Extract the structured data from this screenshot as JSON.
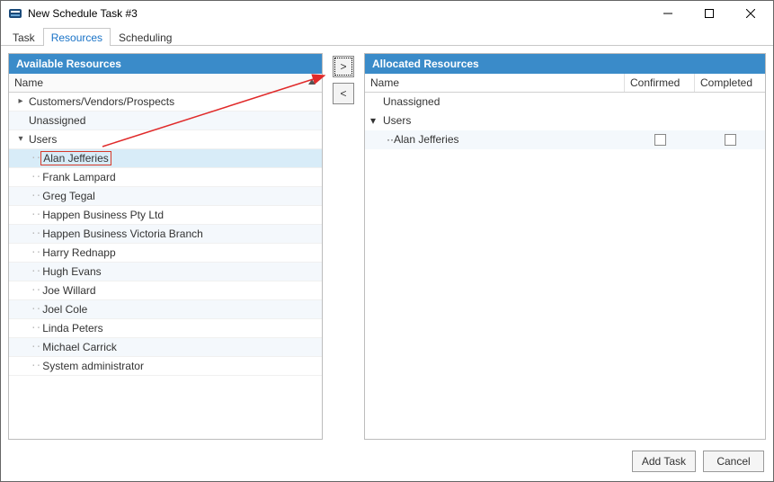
{
  "window": {
    "title": "New Schedule Task #3"
  },
  "tabs": {
    "task": "Task",
    "resources": "Resources",
    "scheduling": "Scheduling"
  },
  "left_panel": {
    "title": "Available Resources",
    "col_name": "Name",
    "groups": {
      "cvp": "Customers/Vendors/Prospects",
      "unassigned": "Unassigned",
      "users": "Users"
    },
    "users": [
      "Alan Jefferies",
      "Frank Lampard",
      "Greg Tegal",
      "Happen Business Pty Ltd",
      "Happen Business Victoria Branch",
      "Harry Rednapp",
      "Hugh Evans",
      "Joe Willard",
      "Joel Cole",
      "Linda Peters",
      "Michael Carrick",
      "System administrator"
    ]
  },
  "buttons": {
    "move_right": ">",
    "move_left": "<",
    "add_task": "Add Task",
    "cancel": "Cancel"
  },
  "right_panel": {
    "title": "Allocated Resources",
    "col_name": "Name",
    "col_confirmed": "Confirmed",
    "col_completed": "Completed",
    "groups": {
      "unassigned": "Unassigned",
      "users": "Users"
    },
    "allocated": [
      "Alan Jefferies"
    ]
  }
}
